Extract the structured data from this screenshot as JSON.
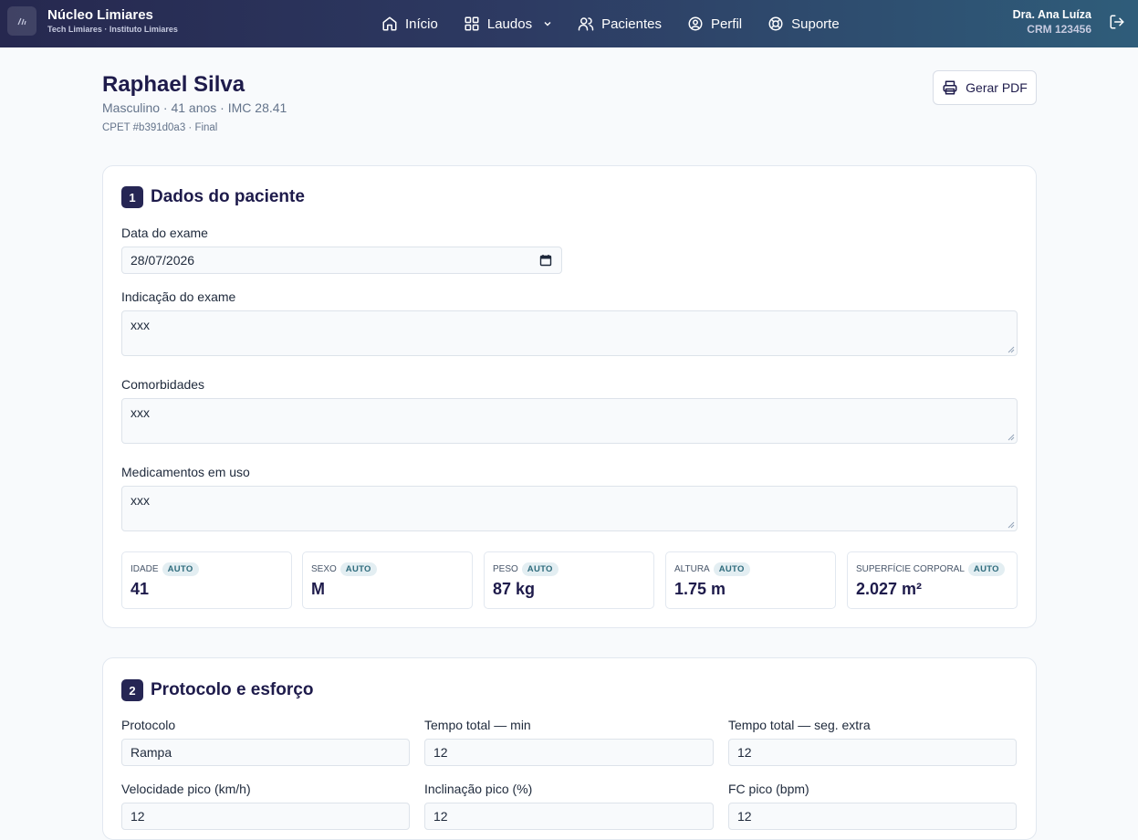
{
  "app": {
    "title": "Núcleo Limiares",
    "subtitle": "Tech Limiares · Instituto Limiares"
  },
  "nav": {
    "items": [
      {
        "label": "Início",
        "icon": "home-icon"
      },
      {
        "label": "Laudos",
        "icon": "grid-icon"
      },
      {
        "label": "Pacientes",
        "icon": "users-icon"
      },
      {
        "label": "Perfil",
        "icon": "user-circle-icon"
      },
      {
        "label": "Suporte",
        "icon": "lifebuoy-icon"
      }
    ]
  },
  "user": {
    "name": "Dra. Ana Luíza",
    "crm": "CRM 123456"
  },
  "patient": {
    "name": "Raphael Silva",
    "meta": "Masculino · 41 anos · IMC 28.41",
    "ref": "CPET #b391d0a3 · Final"
  },
  "actions": {
    "pdf_label": "Gerar PDF"
  },
  "section1": {
    "number": "1",
    "title": "Dados do paciente",
    "exam_date_label": "Data do exame",
    "exam_date_value": "28/07/2026",
    "indication_label": "Indicação do exame",
    "indication_value": "xxx",
    "comorbidities_label": "Comorbidades",
    "comorbidities_value": "xxx",
    "medications_label": "Medicamentos em uso",
    "medications_value": "xxx",
    "auto_badge": "AUTO",
    "stats": [
      {
        "label": "Idade",
        "value": "41"
      },
      {
        "label": "Sexo",
        "value": "M"
      },
      {
        "label": "Peso",
        "value": "87 kg"
      },
      {
        "label": "Altura",
        "value": "1.75 m"
      },
      {
        "label": "Superfície corporal",
        "value": "2.027 m²"
      }
    ]
  },
  "section2": {
    "number": "2",
    "title": "Protocolo e esforço",
    "fields": [
      {
        "label": "Protocolo",
        "value": "Rampa"
      },
      {
        "label": "Tempo total — min",
        "value": "12"
      },
      {
        "label": "Tempo total — seg. extra",
        "value": "12"
      },
      {
        "label": "Velocidade pico (km/h)",
        "value": "12"
      },
      {
        "label": "Inclinação pico (%)",
        "value": "12"
      },
      {
        "label": "FC pico (bpm)",
        "value": "12"
      }
    ]
  },
  "colors": {
    "primary": "#262654",
    "badge_bg": "#e3eef2",
    "badge_text": "#2e6b7c"
  }
}
